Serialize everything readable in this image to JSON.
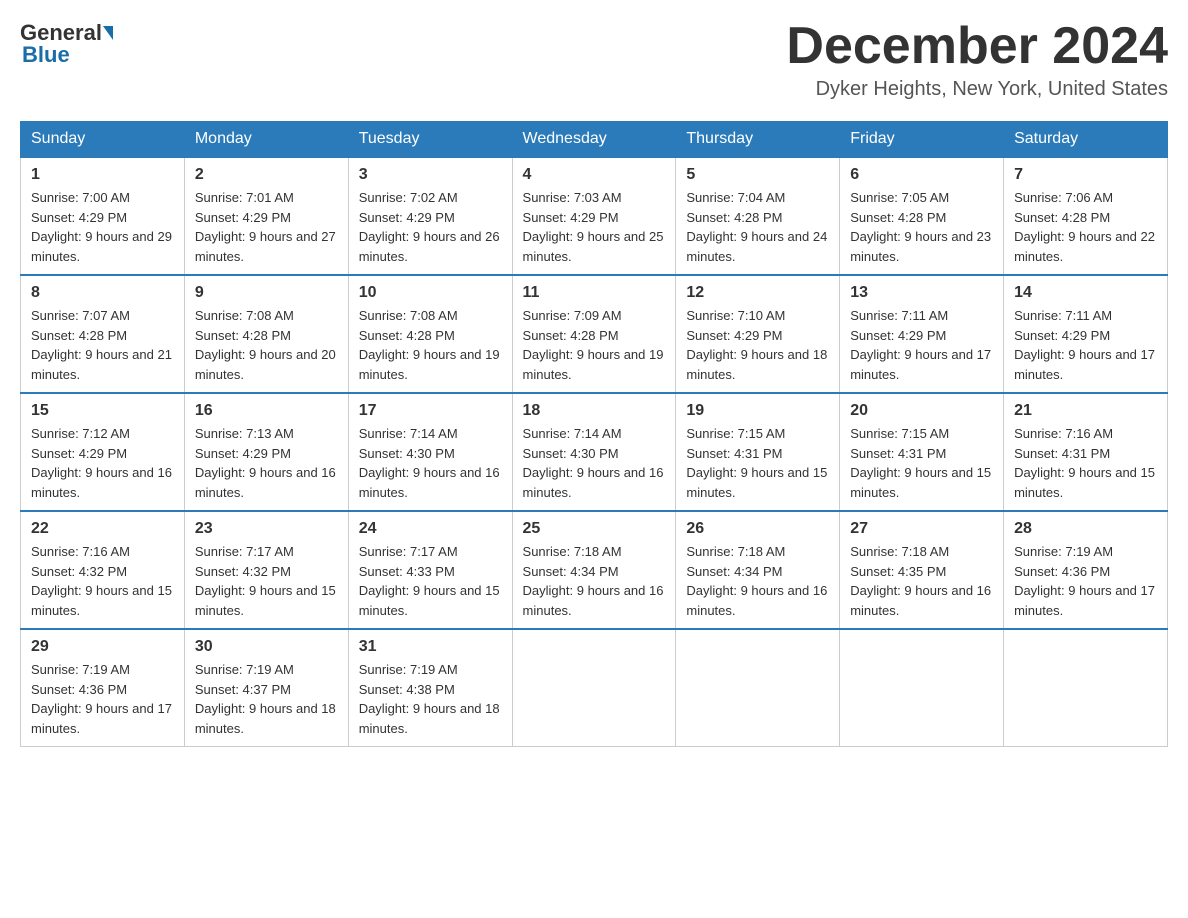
{
  "logo": {
    "general": "General",
    "blue": "Blue"
  },
  "header": {
    "month": "December 2024",
    "location": "Dyker Heights, New York, United States"
  },
  "weekdays": [
    "Sunday",
    "Monday",
    "Tuesday",
    "Wednesday",
    "Thursday",
    "Friday",
    "Saturday"
  ],
  "weeks": [
    [
      {
        "day": "1",
        "sunrise": "7:00 AM",
        "sunset": "4:29 PM",
        "daylight": "9 hours and 29 minutes."
      },
      {
        "day": "2",
        "sunrise": "7:01 AM",
        "sunset": "4:29 PM",
        "daylight": "9 hours and 27 minutes."
      },
      {
        "day": "3",
        "sunrise": "7:02 AM",
        "sunset": "4:29 PM",
        "daylight": "9 hours and 26 minutes."
      },
      {
        "day": "4",
        "sunrise": "7:03 AM",
        "sunset": "4:29 PM",
        "daylight": "9 hours and 25 minutes."
      },
      {
        "day": "5",
        "sunrise": "7:04 AM",
        "sunset": "4:28 PM",
        "daylight": "9 hours and 24 minutes."
      },
      {
        "day": "6",
        "sunrise": "7:05 AM",
        "sunset": "4:28 PM",
        "daylight": "9 hours and 23 minutes."
      },
      {
        "day": "7",
        "sunrise": "7:06 AM",
        "sunset": "4:28 PM",
        "daylight": "9 hours and 22 minutes."
      }
    ],
    [
      {
        "day": "8",
        "sunrise": "7:07 AM",
        "sunset": "4:28 PM",
        "daylight": "9 hours and 21 minutes."
      },
      {
        "day": "9",
        "sunrise": "7:08 AM",
        "sunset": "4:28 PM",
        "daylight": "9 hours and 20 minutes."
      },
      {
        "day": "10",
        "sunrise": "7:08 AM",
        "sunset": "4:28 PM",
        "daylight": "9 hours and 19 minutes."
      },
      {
        "day": "11",
        "sunrise": "7:09 AM",
        "sunset": "4:28 PM",
        "daylight": "9 hours and 19 minutes."
      },
      {
        "day": "12",
        "sunrise": "7:10 AM",
        "sunset": "4:29 PM",
        "daylight": "9 hours and 18 minutes."
      },
      {
        "day": "13",
        "sunrise": "7:11 AM",
        "sunset": "4:29 PM",
        "daylight": "9 hours and 17 minutes."
      },
      {
        "day": "14",
        "sunrise": "7:11 AM",
        "sunset": "4:29 PM",
        "daylight": "9 hours and 17 minutes."
      }
    ],
    [
      {
        "day": "15",
        "sunrise": "7:12 AM",
        "sunset": "4:29 PM",
        "daylight": "9 hours and 16 minutes."
      },
      {
        "day": "16",
        "sunrise": "7:13 AM",
        "sunset": "4:29 PM",
        "daylight": "9 hours and 16 minutes."
      },
      {
        "day": "17",
        "sunrise": "7:14 AM",
        "sunset": "4:30 PM",
        "daylight": "9 hours and 16 minutes."
      },
      {
        "day": "18",
        "sunrise": "7:14 AM",
        "sunset": "4:30 PM",
        "daylight": "9 hours and 16 minutes."
      },
      {
        "day": "19",
        "sunrise": "7:15 AM",
        "sunset": "4:31 PM",
        "daylight": "9 hours and 15 minutes."
      },
      {
        "day": "20",
        "sunrise": "7:15 AM",
        "sunset": "4:31 PM",
        "daylight": "9 hours and 15 minutes."
      },
      {
        "day": "21",
        "sunrise": "7:16 AM",
        "sunset": "4:31 PM",
        "daylight": "9 hours and 15 minutes."
      }
    ],
    [
      {
        "day": "22",
        "sunrise": "7:16 AM",
        "sunset": "4:32 PM",
        "daylight": "9 hours and 15 minutes."
      },
      {
        "day": "23",
        "sunrise": "7:17 AM",
        "sunset": "4:32 PM",
        "daylight": "9 hours and 15 minutes."
      },
      {
        "day": "24",
        "sunrise": "7:17 AM",
        "sunset": "4:33 PM",
        "daylight": "9 hours and 15 minutes."
      },
      {
        "day": "25",
        "sunrise": "7:18 AM",
        "sunset": "4:34 PM",
        "daylight": "9 hours and 16 minutes."
      },
      {
        "day": "26",
        "sunrise": "7:18 AM",
        "sunset": "4:34 PM",
        "daylight": "9 hours and 16 minutes."
      },
      {
        "day": "27",
        "sunrise": "7:18 AM",
        "sunset": "4:35 PM",
        "daylight": "9 hours and 16 minutes."
      },
      {
        "day": "28",
        "sunrise": "7:19 AM",
        "sunset": "4:36 PM",
        "daylight": "9 hours and 17 minutes."
      }
    ],
    [
      {
        "day": "29",
        "sunrise": "7:19 AM",
        "sunset": "4:36 PM",
        "daylight": "9 hours and 17 minutes."
      },
      {
        "day": "30",
        "sunrise": "7:19 AM",
        "sunset": "4:37 PM",
        "daylight": "9 hours and 18 minutes."
      },
      {
        "day": "31",
        "sunrise": "7:19 AM",
        "sunset": "4:38 PM",
        "daylight": "9 hours and 18 minutes."
      },
      null,
      null,
      null,
      null
    ]
  ],
  "labels": {
    "sunrise": "Sunrise:",
    "sunset": "Sunset:",
    "daylight": "Daylight:"
  }
}
